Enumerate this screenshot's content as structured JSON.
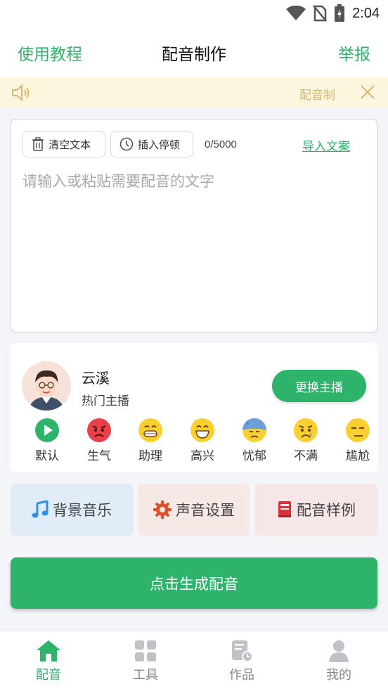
{
  "status_bar": {
    "time": "2:04"
  },
  "header": {
    "left_link": "使用教程",
    "title": "配音制作",
    "right_link": "举报"
  },
  "notice": {
    "text": "配音制"
  },
  "editor": {
    "clear_label": "清空文本",
    "pause_label": "插入停顿",
    "char_count": "0/5000",
    "import_label": "导入文案",
    "placeholder": "请输入或粘贴需要配音的文字"
  },
  "anchor": {
    "name": "云溪",
    "subtitle": "热门主播",
    "change_label": "更换主播",
    "emotions": [
      {
        "label": "默认",
        "icon": "play-icon"
      },
      {
        "label": "生气",
        "icon": "angry-face-icon"
      },
      {
        "label": "助理",
        "icon": "grin-face-icon"
      },
      {
        "label": "高兴",
        "icon": "happy-face-icon"
      },
      {
        "label": "忧郁",
        "icon": "sweat-face-icon"
      },
      {
        "label": "不满",
        "icon": "sad-face-icon"
      },
      {
        "label": "尴尬",
        "icon": "unamused-face-icon"
      }
    ]
  },
  "tiles": {
    "bgm_label": "背景音乐",
    "voice_label": "声音设置",
    "sample_label": "配音样例"
  },
  "generate_label": "点击生成配音",
  "tabbar": {
    "items": [
      {
        "label": "配音",
        "icon": "home-icon",
        "active": true
      },
      {
        "label": "工具",
        "icon": "grid-icon",
        "active": false
      },
      {
        "label": "作品",
        "icon": "document-clock-icon",
        "active": false
      },
      {
        "label": "我的",
        "icon": "person-icon",
        "active": false
      }
    ]
  },
  "colors": {
    "accent": "#2eb36b",
    "notice_bg": "#fdf6df",
    "notice_text": "#d7b870"
  }
}
